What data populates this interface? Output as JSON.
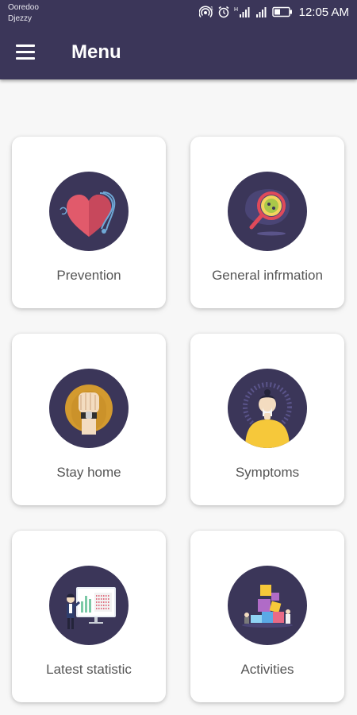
{
  "status_bar": {
    "carrier_1": "Ooredoo",
    "carrier_2": "Djezzy",
    "time": "12:05 AM"
  },
  "header": {
    "title": "Menu",
    "menu_icon": "hamburger-icon"
  },
  "colors": {
    "header_bg": "#3b3659",
    "icon_circle_bg": "#3b3659",
    "label_text": "#555555",
    "page_bg": "#f7f7f7"
  },
  "menu_items": [
    {
      "label": "Prevention",
      "icon": "heart-stethoscope-icon"
    },
    {
      "label": "General infrmation",
      "icon": "virus-magnifier-icon"
    },
    {
      "label": "Stay home",
      "icon": "raised-fist-icon"
    },
    {
      "label": "Symptoms",
      "icon": "sick-person-icon"
    },
    {
      "label": "Latest statistic",
      "icon": "statistics-board-icon"
    },
    {
      "label": "Activities",
      "icon": "activities-blocks-icon"
    }
  ]
}
